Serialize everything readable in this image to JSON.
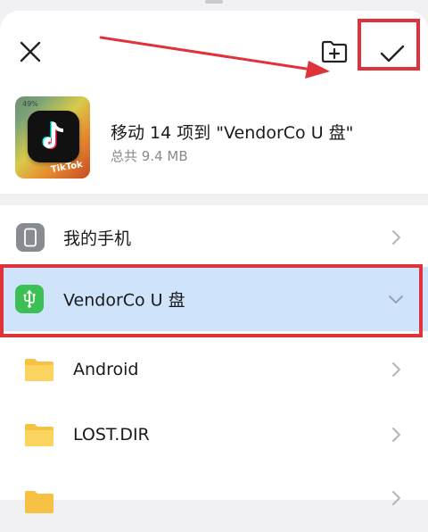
{
  "header": {
    "move_title": "移动 14 项到 \"VendorCo U 盘\"",
    "total_size": "总共 9.4 MB",
    "thumbnail": {
      "status_text": "49%",
      "app_label": "TikTok"
    }
  },
  "icons": {
    "close": "close-icon",
    "new_folder": "new-folder-icon",
    "confirm": "checkmark-icon"
  },
  "locations": [
    {
      "label": "我的手机",
      "icon": "phone-icon",
      "expanded": false
    },
    {
      "label": "VendorCo U 盘",
      "icon": "usb-icon",
      "expanded": true,
      "selected": true
    }
  ],
  "folders": [
    {
      "label": "Android"
    },
    {
      "label": "LOST.DIR"
    }
  ],
  "colors": {
    "selected_row": "#cfe3fb",
    "annotation_red": "#e0323a",
    "usb_green": "#3cbf54",
    "folder_yellow": "#f7c244"
  }
}
